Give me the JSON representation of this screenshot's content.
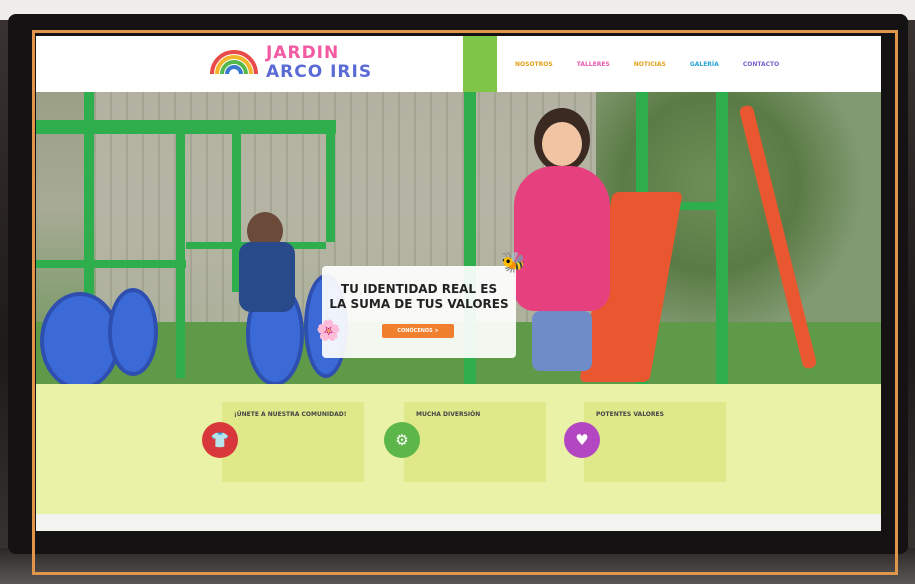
{
  "brand": {
    "line1": "JARDIN",
    "line2": "ARCO IRIS",
    "line1_color": "#f25aa1",
    "line2_color": "#5b6bd6"
  },
  "nav": {
    "home": "",
    "items": [
      {
        "label": "NOSOTROS",
        "color": "#e2a11a"
      },
      {
        "label": "TALLERES",
        "color": "#e85ab0"
      },
      {
        "label": "NOTICIAS",
        "color": "#e2a11a"
      },
      {
        "label": "GALERÍA",
        "color": "#2ba3d6"
      },
      {
        "label": "CONTACTO",
        "color": "#7a5fd0"
      }
    ]
  },
  "hero": {
    "title_line1": "TU IDENTIDAD REAL ES",
    "title_line2": "LA SUMA DE TUS VALORES",
    "button": "CONÓCENOS >"
  },
  "features": [
    {
      "title": "¡ÚNETE A NUESTRA COMUNIDAD!",
      "text": "",
      "color": "#d8383c",
      "icon": "shirt-icon"
    },
    {
      "title": "MUCHA DIVERSIÓN",
      "text": "",
      "color": "#5cb64a",
      "icon": "gear-icon"
    },
    {
      "title": "POTENTES VALORES",
      "text": "",
      "color": "#b347c2",
      "icon": "heart-icon"
    }
  ],
  "colors": {
    "accent_green": "#7fc548",
    "cta_orange": "#f0802e",
    "band": "#eaf2a7",
    "frame": "#e0964a"
  }
}
